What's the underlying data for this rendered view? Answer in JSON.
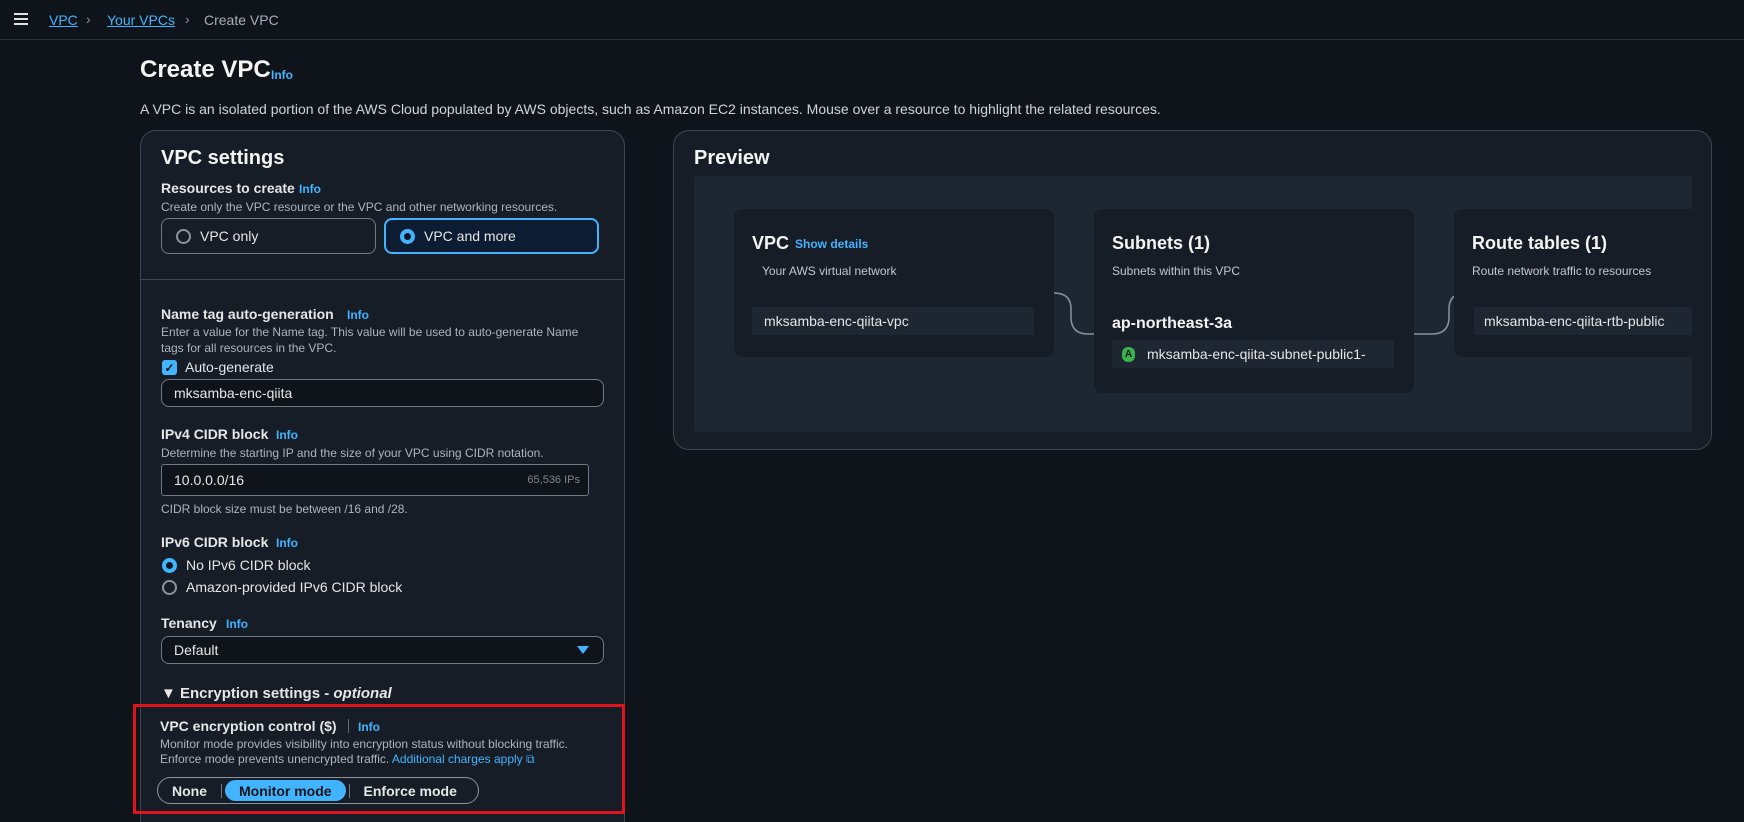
{
  "breadcrumb": {
    "items": [
      "VPC",
      "Your VPCs",
      "Create VPC"
    ]
  },
  "header": {
    "title": "Create VPC",
    "info": "Info",
    "description": "A VPC is an isolated portion of the AWS Cloud populated by AWS objects, such as Amazon EC2 instances. Mouse over a resource to highlight the related resources."
  },
  "settings": {
    "title": "VPC settings",
    "resources": {
      "label": "Resources to create",
      "info": "Info",
      "description": "Create only the VPC resource or the VPC and other networking resources.",
      "options": [
        "VPC only",
        "VPC and more"
      ],
      "selected": "VPC and more"
    },
    "name_tag": {
      "label": "Name tag auto-generation",
      "info": "Info",
      "description": "Enter a value for the Name tag. This value will be used to auto-generate Name tags for all resources in the VPC.",
      "auto_generate_label": "Auto-generate",
      "auto_generate_checked": true,
      "value": "mksamba-enc-qiita"
    },
    "ipv4": {
      "label": "IPv4 CIDR block",
      "info": "Info",
      "description": "Determine the starting IP and the size of your VPC using CIDR notation.",
      "value": "10.0.0.0/16",
      "ip_count": "65,536 IPs",
      "constraint": "CIDR block size must be between /16 and /28."
    },
    "ipv6": {
      "label": "IPv6 CIDR block",
      "info": "Info",
      "options": [
        "No IPv6 CIDR block",
        "Amazon-provided IPv6 CIDR block"
      ],
      "selected": "No IPv6 CIDR block"
    },
    "tenancy": {
      "label": "Tenancy",
      "info": "Info",
      "value": "Default"
    },
    "encryption": {
      "section_label": "Encryption settings - ",
      "section_optional": "optional",
      "control_label": "VPC encryption control ($)",
      "info": "Info",
      "description_line1": "Monitor mode provides visibility into encryption status without blocking traffic.",
      "description_line2": "Enforce mode prevents unencrypted traffic.",
      "charges_link": "Additional charges apply",
      "modes": [
        "None",
        "Monitor mode",
        "Enforce mode"
      ],
      "selected": "Monitor mode"
    }
  },
  "preview": {
    "title": "Preview",
    "vpc": {
      "title": "VPC",
      "show_details": "Show details",
      "subtitle": "Your AWS virtual network",
      "item": "mksamba-enc-qiita-vpc"
    },
    "subnets": {
      "title": "Subnets (1)",
      "subtitle": "Subnets within this VPC",
      "az": "ap-northeast-3a",
      "az_badge": "A",
      "item": "mksamba-enc-qiita-subnet-public1-"
    },
    "route_tables": {
      "title": "Route tables (1)",
      "subtitle": "Route network traffic to resources",
      "item": "mksamba-enc-qiita-rtb-public"
    }
  },
  "colors": {
    "accent": "#42b4ff",
    "highlight_border": "#e0141e",
    "background": "#0f141a",
    "panel": "#161d26"
  }
}
